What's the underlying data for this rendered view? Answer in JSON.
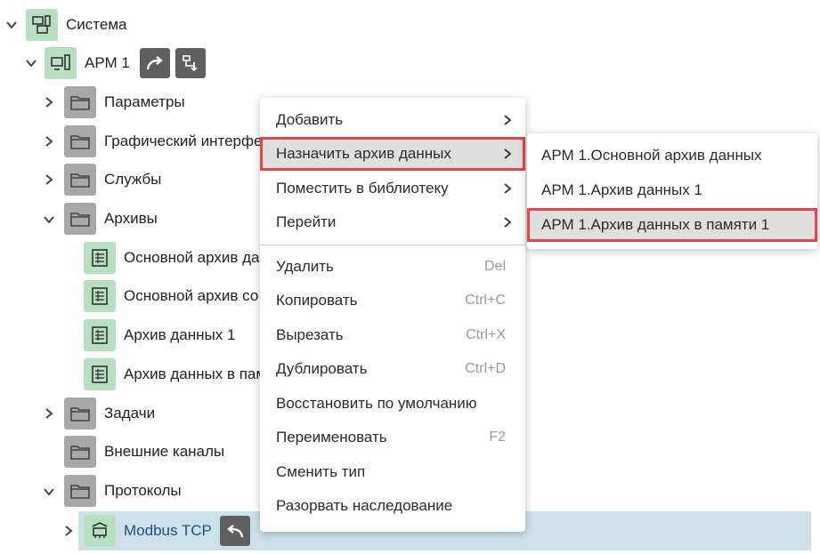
{
  "tree": {
    "root": {
      "label": "Система",
      "icon": "system-icon"
    },
    "arm": {
      "label": "АРМ 1",
      "icon": "workstation-icon"
    },
    "folders": [
      {
        "label": "Параметры"
      },
      {
        "label": "Графический интерфе"
      },
      {
        "label": "Службы"
      },
      {
        "label": "Архивы"
      }
    ],
    "archives": [
      {
        "label": "Основной архив да"
      },
      {
        "label": "Основной архив со"
      },
      {
        "label": "Архив данных 1"
      },
      {
        "label": "Архив данных в пам"
      }
    ],
    "folders2": [
      {
        "label": "Задачи"
      },
      {
        "label": "Внешние каналы"
      },
      {
        "label": "Протоколы"
      }
    ],
    "modbus": {
      "label": "Modbus TCP"
    }
  },
  "context_menu": {
    "items": [
      {
        "label": "Добавить"
      },
      {
        "label": "Назначить архив данных"
      },
      {
        "label": "Поместить в библиотеку"
      },
      {
        "label": "Перейти"
      },
      {
        "label": "Удалить",
        "shortcut": "Del"
      },
      {
        "label": "Копировать",
        "shortcut": "Ctrl+C"
      },
      {
        "label": "Вырезать",
        "shortcut": "Ctrl+X"
      },
      {
        "label": "Дублировать",
        "shortcut": "Ctrl+D"
      },
      {
        "label": "Восстановить по умолчанию"
      },
      {
        "label": "Переименовать",
        "shortcut": "F2"
      },
      {
        "label": "Сменить тип"
      },
      {
        "label": "Разорвать наследование"
      }
    ]
  },
  "submenu": {
    "items": [
      {
        "label": "АРМ 1.Основной архив данных"
      },
      {
        "label": "АРМ 1.Архив данных 1"
      },
      {
        "label": "АРМ 1.Архив данных в памяти 1"
      }
    ]
  },
  "colors": {
    "green_icon_bg": "#b9dfc2",
    "gray_icon_bg": "#a8a8a8",
    "selected_row": "#cde1ea",
    "highlight_border": "#e0474a",
    "link_text": "#1f4e8c"
  }
}
